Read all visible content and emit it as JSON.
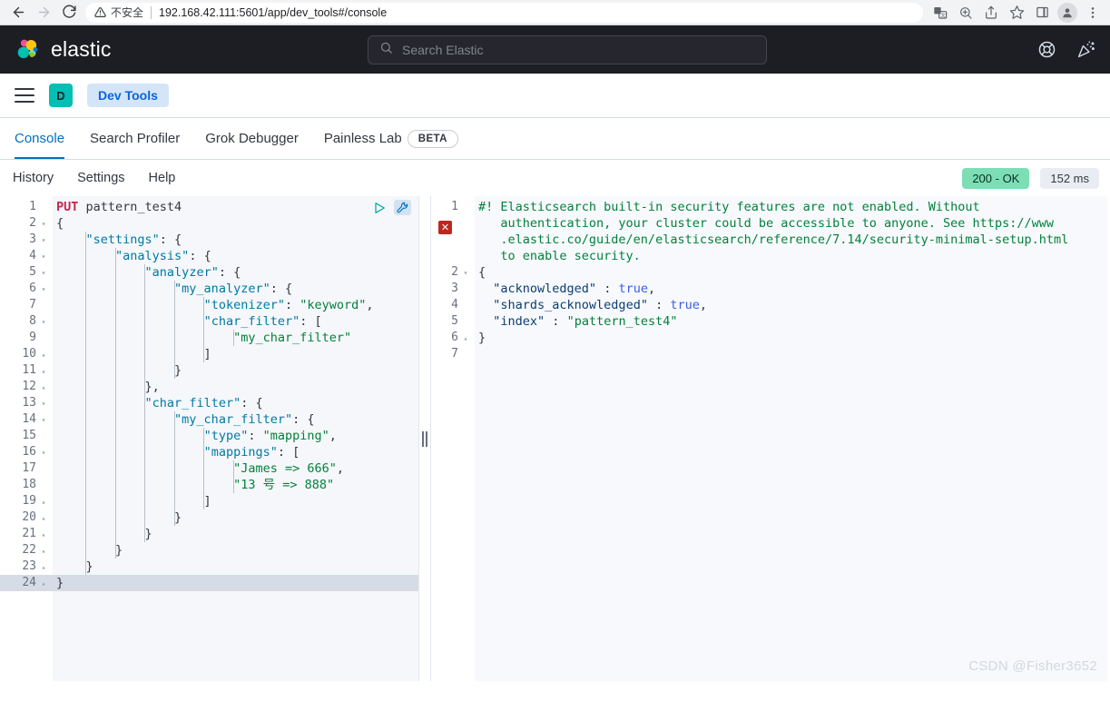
{
  "browser": {
    "back_icon": "arrow-left-icon",
    "forward_icon": "arrow-right-icon",
    "reload_icon": "reload-icon",
    "security_label": "不安全",
    "url": "192.168.42.111:5601/app/dev_tools#/console",
    "icons": [
      "translate-icon",
      "zoom-icon",
      "share-icon",
      "bookmark-star-icon",
      "side-panel-icon",
      "profile-avatar-icon",
      "kebab-menu-icon"
    ]
  },
  "header": {
    "brand": "elastic",
    "search_placeholder": "Search Elastic",
    "help_icon": "lifebuoy-help-icon",
    "news_icon": "news-feed-icon"
  },
  "nav": {
    "menu_icon": "hamburger-menu-icon",
    "space_initial": "D",
    "breadcrumb": "Dev Tools"
  },
  "tabs": [
    {
      "label": "Console",
      "active": true
    },
    {
      "label": "Search Profiler",
      "active": false
    },
    {
      "label": "Grok Debugger",
      "active": false
    },
    {
      "label": "Painless Lab",
      "active": false
    }
  ],
  "beta_badge": "BETA",
  "toolbar": {
    "links": [
      "History",
      "Settings",
      "Help"
    ],
    "status_code": "200 - OK",
    "duration": "152 ms",
    "play_icon": "play-request-icon",
    "wrench_icon": "wrench-settings-icon"
  },
  "request_editor": {
    "active_line": 24,
    "lines": [
      {
        "n": 1,
        "fold": "",
        "tokens": [
          {
            "t": "PUT",
            "c": "k-method"
          },
          {
            "t": " pattern_test4",
            "c": "k-url"
          }
        ]
      },
      {
        "n": 2,
        "fold": "open",
        "tokens": [
          {
            "t": "{",
            "c": "k-punc"
          }
        ]
      },
      {
        "n": 3,
        "fold": "open",
        "tokens": [
          {
            "t": "    ",
            "c": "k-punc"
          },
          {
            "t": "\"settings\"",
            "c": "k-key"
          },
          {
            "t": ": {",
            "c": "k-punc"
          }
        ]
      },
      {
        "n": 4,
        "fold": "open",
        "tokens": [
          {
            "t": "        ",
            "c": "k-punc"
          },
          {
            "t": "\"analysis\"",
            "c": "k-key"
          },
          {
            "t": ": {",
            "c": "k-punc"
          }
        ]
      },
      {
        "n": 5,
        "fold": "open",
        "tokens": [
          {
            "t": "            ",
            "c": "k-punc"
          },
          {
            "t": "\"analyzer\"",
            "c": "k-key"
          },
          {
            "t": ": {",
            "c": "k-punc"
          }
        ]
      },
      {
        "n": 6,
        "fold": "open",
        "tokens": [
          {
            "t": "                ",
            "c": "k-punc"
          },
          {
            "t": "\"my_analyzer\"",
            "c": "k-key"
          },
          {
            "t": ": {",
            "c": "k-punc"
          }
        ]
      },
      {
        "n": 7,
        "fold": "",
        "tokens": [
          {
            "t": "                    ",
            "c": "k-punc"
          },
          {
            "t": "\"tokenizer\"",
            "c": "k-key"
          },
          {
            "t": ": ",
            "c": "k-punc"
          },
          {
            "t": "\"keyword\"",
            "c": "k-str"
          },
          {
            "t": ",",
            "c": "k-punc"
          }
        ]
      },
      {
        "n": 8,
        "fold": "open",
        "tokens": [
          {
            "t": "                    ",
            "c": "k-punc"
          },
          {
            "t": "\"char_filter\"",
            "c": "k-key"
          },
          {
            "t": ": [",
            "c": "k-punc"
          }
        ]
      },
      {
        "n": 9,
        "fold": "",
        "tokens": [
          {
            "t": "                        ",
            "c": "k-punc"
          },
          {
            "t": "\"my_char_filter\"",
            "c": "k-str"
          }
        ]
      },
      {
        "n": 10,
        "fold": "close",
        "tokens": [
          {
            "t": "                    ]",
            "c": "k-punc"
          }
        ]
      },
      {
        "n": 11,
        "fold": "close",
        "tokens": [
          {
            "t": "                }",
            "c": "k-punc"
          }
        ]
      },
      {
        "n": 12,
        "fold": "close",
        "tokens": [
          {
            "t": "            },",
            "c": "k-punc"
          }
        ]
      },
      {
        "n": 13,
        "fold": "open",
        "tokens": [
          {
            "t": "            ",
            "c": "k-punc"
          },
          {
            "t": "\"char_filter\"",
            "c": "k-key"
          },
          {
            "t": ": {",
            "c": "k-punc"
          }
        ]
      },
      {
        "n": 14,
        "fold": "open",
        "tokens": [
          {
            "t": "                ",
            "c": "k-punc"
          },
          {
            "t": "\"my_char_filter\"",
            "c": "k-key"
          },
          {
            "t": ": {",
            "c": "k-punc"
          }
        ]
      },
      {
        "n": 15,
        "fold": "",
        "tokens": [
          {
            "t": "                    ",
            "c": "k-punc"
          },
          {
            "t": "\"type\"",
            "c": "k-key"
          },
          {
            "t": ": ",
            "c": "k-punc"
          },
          {
            "t": "\"mapping\"",
            "c": "k-str"
          },
          {
            "t": ",",
            "c": "k-punc"
          }
        ]
      },
      {
        "n": 16,
        "fold": "open",
        "tokens": [
          {
            "t": "                    ",
            "c": "k-punc"
          },
          {
            "t": "\"mappings\"",
            "c": "k-key"
          },
          {
            "t": ": [",
            "c": "k-punc"
          }
        ]
      },
      {
        "n": 17,
        "fold": "",
        "tokens": [
          {
            "t": "                        ",
            "c": "k-punc"
          },
          {
            "t": "\"James => 666\"",
            "c": "k-str"
          },
          {
            "t": ",",
            "c": "k-punc"
          }
        ]
      },
      {
        "n": 18,
        "fold": "",
        "tokens": [
          {
            "t": "                        ",
            "c": "k-punc"
          },
          {
            "t": "\"13 号 => 888\"",
            "c": "k-str"
          }
        ]
      },
      {
        "n": 19,
        "fold": "close",
        "tokens": [
          {
            "t": "                    ]",
            "c": "k-punc"
          }
        ]
      },
      {
        "n": 20,
        "fold": "close",
        "tokens": [
          {
            "t": "                }",
            "c": "k-punc"
          }
        ]
      },
      {
        "n": 21,
        "fold": "close",
        "tokens": [
          {
            "t": "            }",
            "c": "k-punc"
          }
        ]
      },
      {
        "n": 22,
        "fold": "close",
        "tokens": [
          {
            "t": "        }",
            "c": "k-punc"
          }
        ]
      },
      {
        "n": 23,
        "fold": "close",
        "tokens": [
          {
            "t": "    }",
            "c": "k-punc"
          }
        ]
      },
      {
        "n": 24,
        "fold": "close",
        "tokens": [
          {
            "t": "}",
            "c": "k-punc"
          }
        ]
      }
    ]
  },
  "response_editor": {
    "error_marker": "error-marker-icon",
    "lines": [
      {
        "n": 1,
        "fold": "",
        "tokens": [
          {
            "t": "#! Elasticsearch built-in security features are not enabled. Without",
            "c": "k-comment"
          }
        ]
      },
      {
        "n": "",
        "fold": "",
        "tokens": [
          {
            "t": "   authentication, your cluster could be accessible to anyone. See https://www",
            "c": "k-comment"
          }
        ]
      },
      {
        "n": "",
        "fold": "",
        "tokens": [
          {
            "t": "   .elastic.co/guide/en/elasticsearch/reference/7.14/security-minimal-setup.html",
            "c": "k-comment"
          }
        ]
      },
      {
        "n": "",
        "fold": "",
        "tokens": [
          {
            "t": "   to enable security.",
            "c": "k-comment"
          }
        ]
      },
      {
        "n": 2,
        "fold": "open",
        "tokens": [
          {
            "t": "{",
            "c": "k-punc"
          }
        ]
      },
      {
        "n": 3,
        "fold": "",
        "tokens": [
          {
            "t": "  ",
            "c": "k-punc"
          },
          {
            "t": "\"acknowledged\"",
            "c": "k-rkey"
          },
          {
            "t": " : ",
            "c": "k-punc"
          },
          {
            "t": "true",
            "c": "k-bool"
          },
          {
            "t": ",",
            "c": "k-punc"
          }
        ]
      },
      {
        "n": 4,
        "fold": "",
        "tokens": [
          {
            "t": "  ",
            "c": "k-punc"
          },
          {
            "t": "\"shards_acknowledged\"",
            "c": "k-rkey"
          },
          {
            "t": " : ",
            "c": "k-punc"
          },
          {
            "t": "true",
            "c": "k-bool"
          },
          {
            "t": ",",
            "c": "k-punc"
          }
        ]
      },
      {
        "n": 5,
        "fold": "",
        "tokens": [
          {
            "t": "  ",
            "c": "k-punc"
          },
          {
            "t": "\"index\"",
            "c": "k-rkey"
          },
          {
            "t": " : ",
            "c": "k-punc"
          },
          {
            "t": "\"pattern_test4\"",
            "c": "k-str"
          }
        ]
      },
      {
        "n": 6,
        "fold": "close",
        "tokens": [
          {
            "t": "}",
            "c": "k-punc"
          }
        ]
      },
      {
        "n": 7,
        "fold": "",
        "tokens": []
      }
    ]
  },
  "watermark": "CSDN @Fisher3652",
  "colors": {
    "elastic_dark": "#1d1e24",
    "accent_blue": "#0071c2",
    "teal": "#00bfb3",
    "status_green": "#7ddeb6",
    "error_red": "#bd271e"
  }
}
